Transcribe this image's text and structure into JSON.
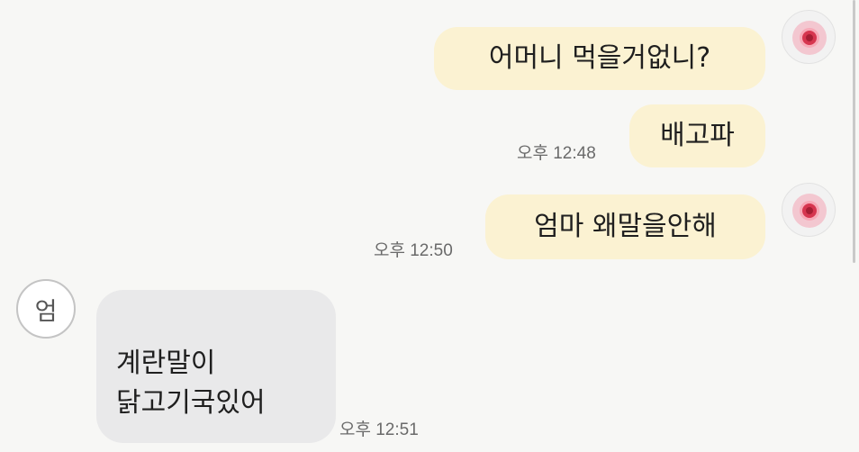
{
  "messages": [
    {
      "text": "어머니 먹을거없니?"
    },
    {
      "text": "배고파",
      "time": "오후 12:48"
    },
    {
      "text": "엄마 왜말을안해",
      "time": "오후 12:50"
    },
    {
      "lines": [
        "계란말이",
        "닭고기국있어"
      ],
      "time": "오후 12:51",
      "sender_initial": "엄"
    }
  ],
  "colors": {
    "outgoing_bubble": "#fbf2d2",
    "incoming_bubble": "#e9e9ea",
    "background": "#f7f7f5"
  },
  "icons": {
    "my_avatar": "pink-flower-avatar-icon"
  }
}
